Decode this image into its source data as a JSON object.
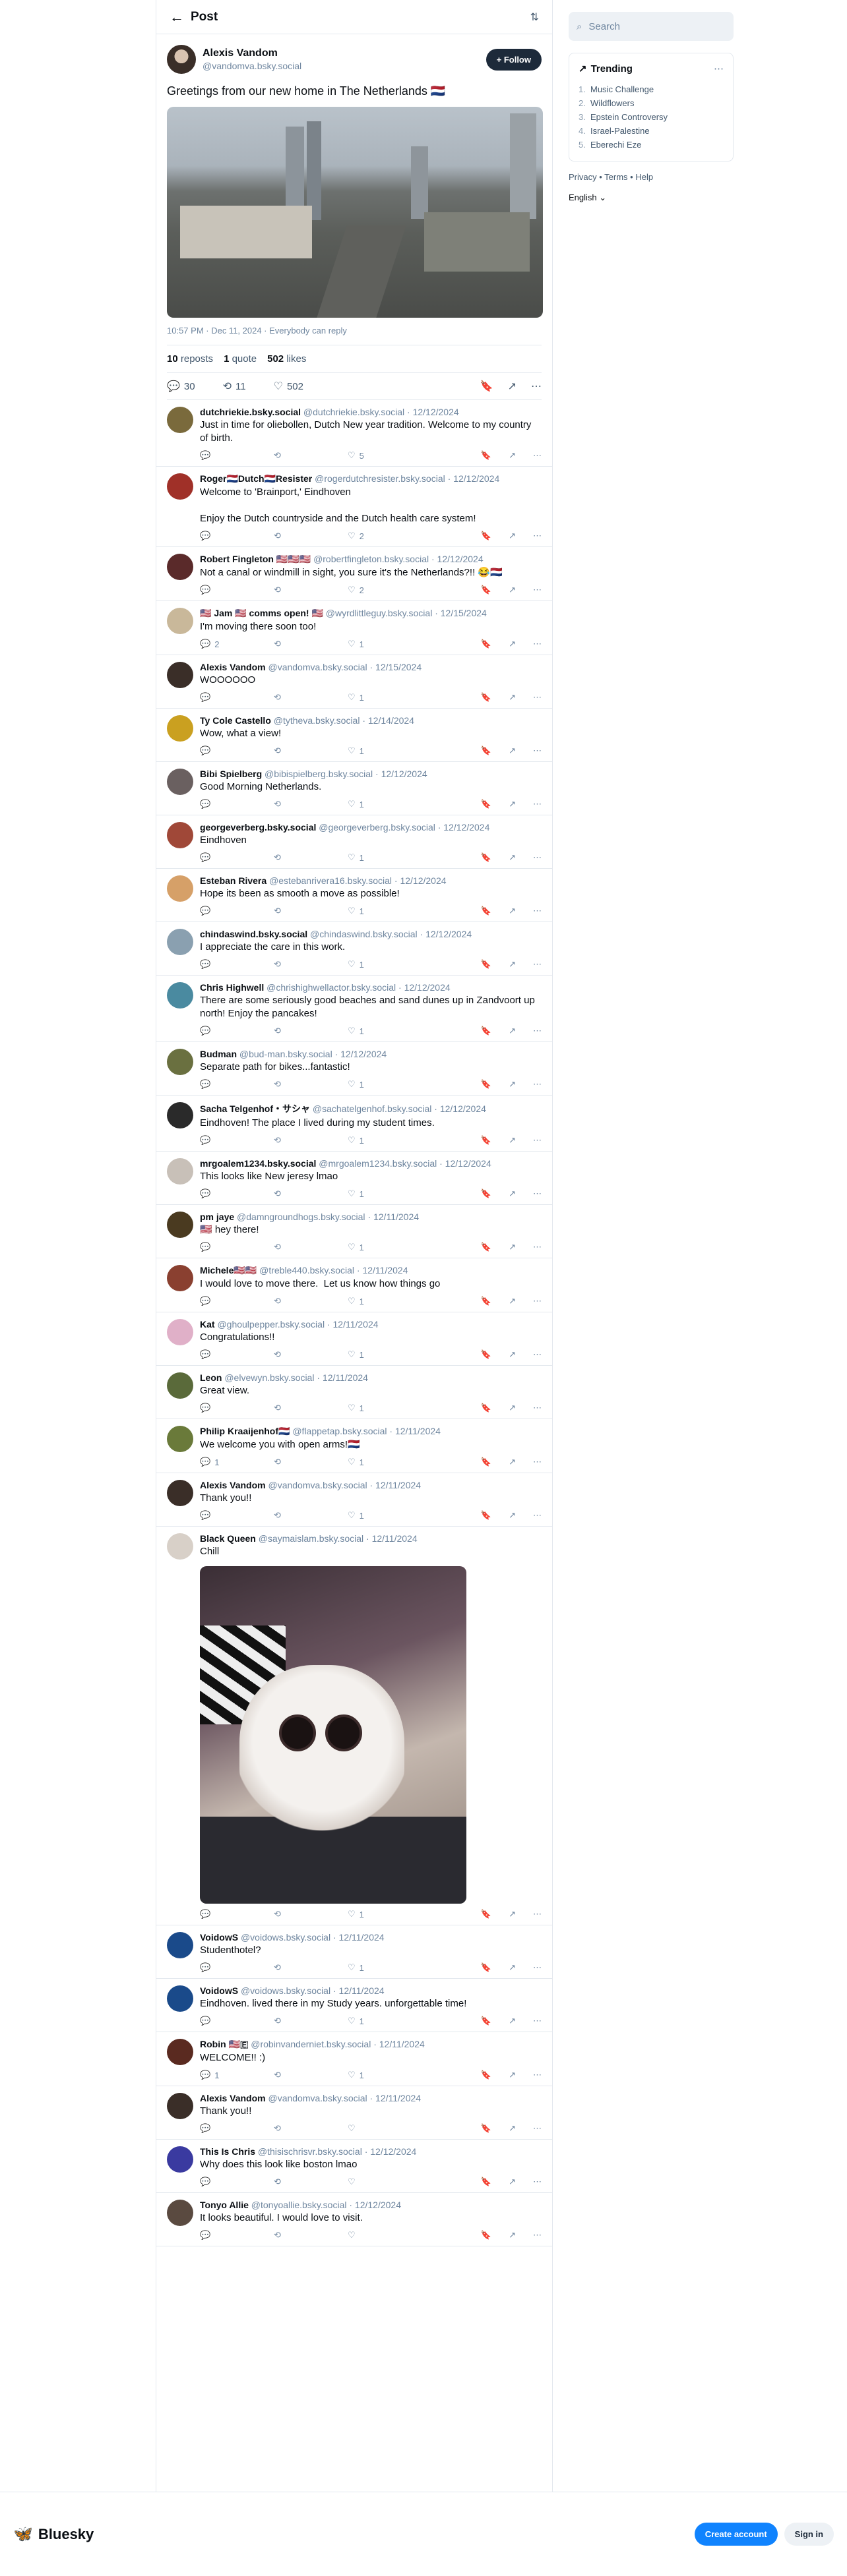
{
  "header": {
    "title": "Post"
  },
  "op": {
    "name": "Alexis Vandom",
    "handle": "@vandomva.bsky.social",
    "follow_label": "Follow",
    "text": "Greetings from our new home in The Netherlands 🇳🇱",
    "meta": "10:57 PM · Dec 11, 2024 · Everybody can reply",
    "stats": {
      "reposts": "10",
      "reposts_label": "reposts",
      "quotes": "1",
      "quotes_label": "quote",
      "likes": "502",
      "likes_label": "likes"
    },
    "actions": {
      "replies": "30",
      "reposts": "11",
      "likes": "502"
    }
  },
  "replies": [
    {
      "name": "dutchriekie.bsky.social",
      "handle": "@dutchriekie.bsky.social",
      "date": "· 12/12/2024",
      "text": "Just in time for oliebollen, Dutch New year tradition. Welcome to my country of birth.",
      "reply_count": "",
      "like_count": "5",
      "avatar": "#7a6a3c"
    },
    {
      "name": "Roger🇳🇱Dutch🇳🇱Resister",
      "handle": "@rogerdutchresister.bsky.social",
      "date": "· 12/12/2024",
      "text": "Welcome to 'Brainport,' Eindhoven\n\nEnjoy the Dutch countryside and the Dutch health care system!",
      "reply_count": "",
      "like_count": "2",
      "avatar": "#a03028"
    },
    {
      "name": "Robert Fingleton 🇺🇸🇺🇸🇺🇸",
      "handle": "@robertfingleton.bsky.social",
      "date": "· 12/12/2024",
      "text": "Not a canal or windmill in sight, you sure it's the Netherlands?!! 😂🇳🇱",
      "reply_count": "",
      "like_count": "2",
      "avatar": "#5a2a2a"
    },
    {
      "name": "🇺🇸 Jam 🇺🇸 comms open! 🇺🇸",
      "handle": "@wyrdlittleguy.bsky.social",
      "date": "· 12/15/2024",
      "text": "I'm moving there soon too!",
      "reply_count": "2",
      "like_count": "1",
      "avatar": "#c9b89a"
    },
    {
      "name": "Alexis Vandom",
      "handle": "@vandomva.bsky.social",
      "date": "· 12/15/2024",
      "text": "WOOOOOO",
      "reply_count": "",
      "like_count": "1",
      "avatar": "#3a2e28"
    },
    {
      "name": "Ty Cole Castello",
      "handle": "@tytheva.bsky.social",
      "date": "· 12/14/2024",
      "text": "Wow, what a view!",
      "reply_count": "",
      "like_count": "1",
      "avatar": "#caa020"
    },
    {
      "name": "Bibi Spielberg",
      "handle": "@bibispielberg.bsky.social",
      "date": "· 12/12/2024",
      "text": "Good Morning Netherlands.",
      "reply_count": "",
      "like_count": "1",
      "avatar": "#6a6060"
    },
    {
      "name": "georgeverberg.bsky.social",
      "handle": "@georgeverberg.bsky.social",
      "date": "· 12/12/2024",
      "text": "Eindhoven",
      "reply_count": "",
      "like_count": "1",
      "avatar": "#a04838"
    },
    {
      "name": "Esteban Rivera",
      "handle": "@estebanrivera16.bsky.social",
      "date": "· 12/12/2024",
      "text": "Hope its been as smooth a move as possible!",
      "reply_count": "",
      "like_count": "1",
      "avatar": "#d6a068"
    },
    {
      "name": "chindaswind.bsky.social",
      "handle": "@chindaswind.bsky.social",
      "date": "· 12/12/2024",
      "text": "I appreciate the care in this work.",
      "reply_count": "",
      "like_count": "1",
      "avatar": "#8aa0b0"
    },
    {
      "name": "Chris Highwell",
      "handle": "@chrishighwellactor.bsky.social",
      "date": "· 12/12/2024",
      "text": "There are some seriously good beaches and sand dunes up in Zandvoort up north! Enjoy the pancakes!",
      "reply_count": "",
      "like_count": "1",
      "avatar": "#4a8aa0"
    },
    {
      "name": "Budman",
      "handle": "@bud-man.bsky.social",
      "date": "· 12/12/2024",
      "text": "Separate path for bikes...fantastic!",
      "reply_count": "",
      "like_count": "1",
      "avatar": "#6a7040"
    },
    {
      "name": "Sacha Telgenhof・サシャ",
      "handle": "@sachatelgenhof.bsky.social",
      "date": "· 12/12/2024",
      "text": "Eindhoven! The place I lived during my student times.",
      "reply_count": "",
      "like_count": "1",
      "avatar": "#2a2a2a"
    },
    {
      "name": "mrgoalem1234.bsky.social",
      "handle": "@mrgoalem1234.bsky.social",
      "date": "· 12/12/2024",
      "text": "This looks like New jeresy lmao",
      "reply_count": "",
      "like_count": "1",
      "avatar": "#c8c0b8"
    },
    {
      "name": "pm jaye",
      "handle": "@damngroundhogs.bsky.social",
      "date": "· 12/11/2024",
      "text": "🇺🇸 hey there!",
      "reply_count": "",
      "like_count": "1",
      "avatar": "#4a3a20"
    },
    {
      "name": "Michele🇺🇸🇺🇸",
      "handle": "@treble440.bsky.social",
      "date": "· 12/11/2024",
      "text": "I would love to move there.  Let us know how things go",
      "reply_count": "",
      "like_count": "1",
      "avatar": "#8a4030"
    },
    {
      "name": "Kat",
      "handle": "@ghoulpepper.bsky.social",
      "date": "· 12/11/2024",
      "text": "Congratulations!!",
      "reply_count": "",
      "like_count": "1",
      "avatar": "#e0b0c8"
    },
    {
      "name": "Leon",
      "handle": "@elvewyn.bsky.social",
      "date": "· 12/11/2024",
      "text": "Great view.",
      "reply_count": "",
      "like_count": "1",
      "avatar": "#5a6a3a"
    },
    {
      "name": "Philip Kraaijenhof🇳🇱",
      "handle": "@flappetap.bsky.social",
      "date": "· 12/11/2024",
      "text": "We welcome you with open arms!🇳🇱",
      "reply_count": "1",
      "like_count": "1",
      "avatar": "#6a7a3a"
    },
    {
      "name": "Alexis Vandom",
      "handle": "@vandomva.bsky.social",
      "date": "· 12/11/2024",
      "text": "Thank you!!",
      "reply_count": "",
      "like_count": "1",
      "avatar": "#3a2e28"
    },
    {
      "name": "Black Queen",
      "handle": "@saymaislam.bsky.social",
      "date": "· 12/11/2024",
      "text": "Chill",
      "reply_count": "",
      "like_count": "1",
      "avatar": "#d8d0c8",
      "has_image": true
    },
    {
      "name": "VoidowS",
      "handle": "@voidows.bsky.social",
      "date": "· 12/11/2024",
      "text": "Studenthotel?",
      "reply_count": "",
      "like_count": "1",
      "avatar": "#1a4a8a"
    },
    {
      "name": "VoidowS",
      "handle": "@voidows.bsky.social",
      "date": "· 12/11/2024",
      "text": "Eindhoven. lived there in my Study years. unforgettable time!",
      "reply_count": "",
      "like_count": "1",
      "avatar": "#1a4a8a"
    },
    {
      "name": "Robin 🇺🇸🇪",
      "handle": "@robinvanderniet.bsky.social",
      "date": "· 12/11/2024",
      "text": "WELCOME!! :)",
      "reply_count": "1",
      "like_count": "1",
      "avatar": "#5a2a20"
    },
    {
      "name": "Alexis Vandom",
      "handle": "@vandomva.bsky.social",
      "date": "· 12/11/2024",
      "text": "Thank you!!",
      "reply_count": "",
      "like_count": "",
      "avatar": "#3a2e28"
    },
    {
      "name": "This Is Chris",
      "handle": "@thisischrisvr.bsky.social",
      "date": "· 12/12/2024",
      "text": "Why does this look like boston lmao",
      "reply_count": "",
      "like_count": "",
      "avatar": "#3a3aa0"
    },
    {
      "name": "Tonyo Allie",
      "handle": "@tonyoallie.bsky.social",
      "date": "· 12/12/2024",
      "text": "It looks beautiful. I would love to visit.",
      "reply_count": "",
      "like_count": "",
      "avatar": "#5a4a40"
    }
  ],
  "sidebar": {
    "search_placeholder": "Search",
    "trending_title": "Trending",
    "trending": [
      "Music Challenge",
      "Wildflowers",
      "Epstein Controversy",
      "Israel-Palestine",
      "Eberechi Eze"
    ],
    "links": "Privacy • Terms • Help",
    "language": "English"
  },
  "footer": {
    "brand": "Bluesky",
    "create_account": "Create account",
    "sign_in": "Sign in"
  },
  "colors": {
    "accent": "#1083fe",
    "follow_bg": "#1d2a3a",
    "muted": "#6f869f"
  }
}
